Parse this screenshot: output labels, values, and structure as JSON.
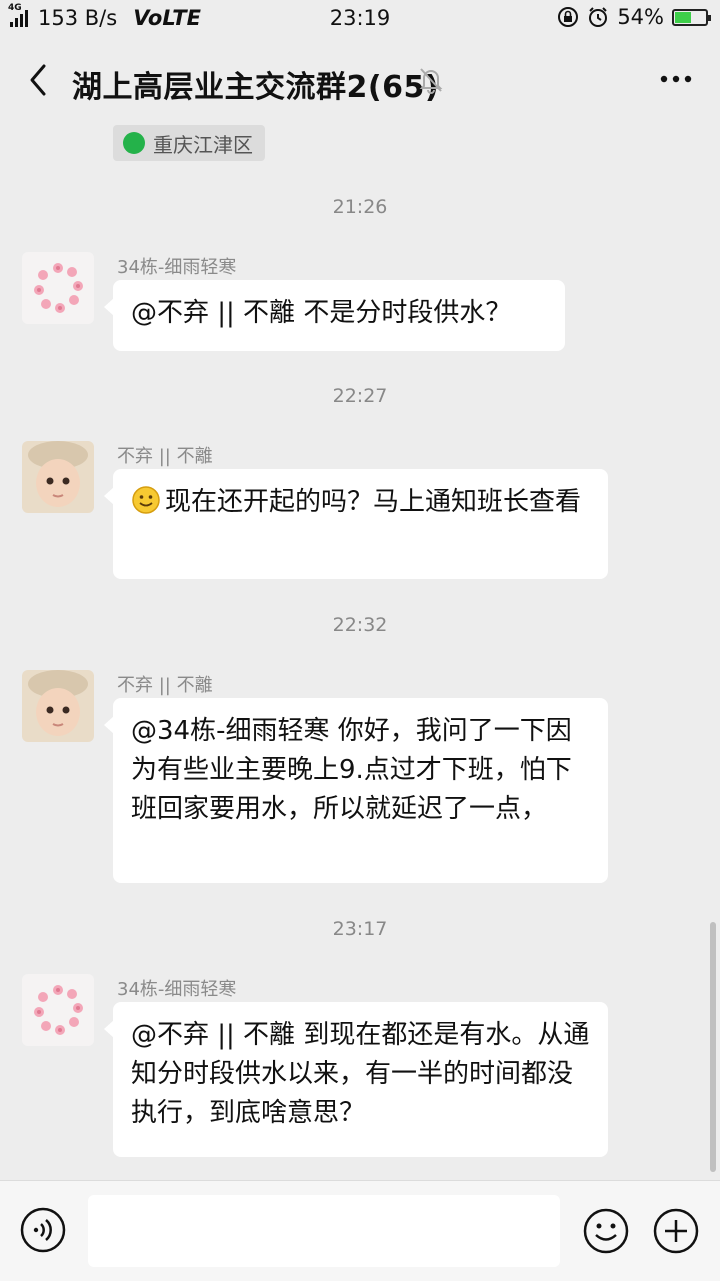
{
  "status_bar": {
    "network_type": "4G",
    "net_speed": "153 B/s",
    "volte": "VoLTE",
    "time": "23:19",
    "battery_percent": "54%",
    "battery_level": 0.54,
    "icons": [
      "signal-icon",
      "screen-lock-icon",
      "alarm-icon",
      "battery-icon"
    ]
  },
  "header": {
    "back_icon": "chevron-left-icon",
    "title": "湖上高层业主交流群2(65)",
    "mute_icon": "bell-muted-icon",
    "more_icon": "more-dots-icon"
  },
  "location_chip": {
    "label": "重庆江津区"
  },
  "messages": [
    {
      "time": "21:26",
      "sender": "34栋-细雨轻寒",
      "avatar": "flower-wreath-avatar",
      "text": "@不弃 || 不離 不是分时段供水？"
    },
    {
      "time": "22:27",
      "sender": "不弃 || 不離",
      "avatar": "baby-photo-avatar",
      "emoji": "smile-emoji",
      "text": "现在还开起的吗？马上通知班长查看"
    },
    {
      "time": "22:32",
      "sender": "不弃 || 不離",
      "avatar": "baby-photo-avatar",
      "text": "@34栋-细雨轻寒  你好，我问了一下因为有些业主要晚上9.点过才下班，怕下班回家要用水，所以就延迟了一点，"
    },
    {
      "time": "23:17",
      "sender": "34栋-细雨轻寒",
      "avatar": "flower-wreath-avatar",
      "text": "@不弃 || 不離 到现在都还是有水。从通知分时段供水以来，有一半的时间都没执行，到底啥意思？"
    }
  ],
  "input_bar": {
    "value": "",
    "voice_icon": "voice-icon",
    "emoji_icon": "emoji-icon",
    "plus_icon": "plus-icon"
  }
}
